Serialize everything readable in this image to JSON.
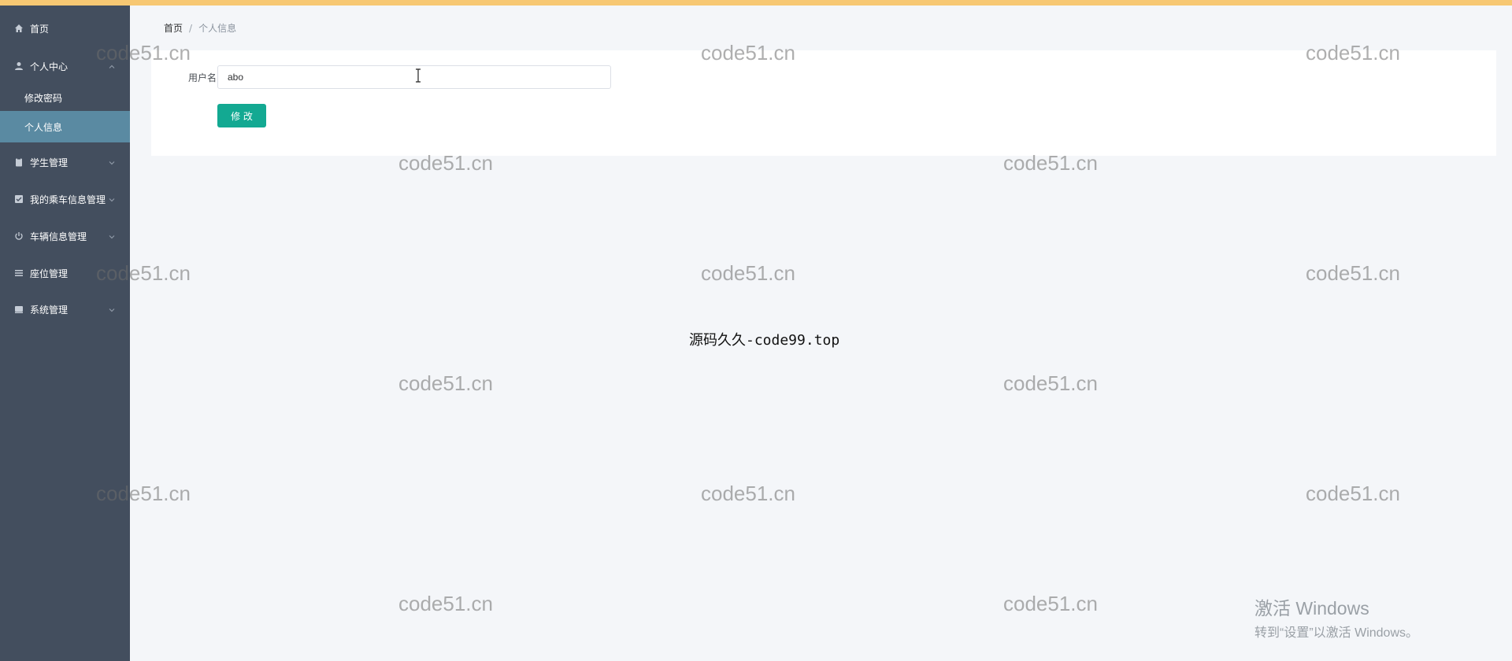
{
  "sidebar": {
    "items": [
      {
        "label": "首页",
        "icon": "home-icon"
      },
      {
        "label": "个人中心",
        "icon": "user-icon"
      },
      {
        "label": "学生管理",
        "icon": "clipboard-icon"
      },
      {
        "label": "我的乘车信息管理",
        "icon": "checkbox-icon"
      },
      {
        "label": "车辆信息管理",
        "icon": "power-icon"
      },
      {
        "label": "座位管理",
        "icon": "list-icon"
      },
      {
        "label": "系统管理",
        "icon": "drive-icon"
      }
    ],
    "submenu": [
      {
        "label": "修改密码",
        "active": false
      },
      {
        "label": "个人信息",
        "active": true
      }
    ]
  },
  "breadcrumb": {
    "home": "首页",
    "separator": "/",
    "current": "个人信息"
  },
  "form": {
    "username_label": "用户名",
    "username_value": "abo",
    "submit_label": "修 改"
  },
  "watermark": {
    "text": "code51.cn"
  },
  "center_text": "源码久久-code99.top",
  "activation": {
    "line1": "激活 Windows",
    "line2": "转到“设置”以激活 Windows。"
  },
  "colors": {
    "sidebar_bg": "#434e5e",
    "active_item_bg": "#5a8aa2",
    "primary_button": "#13a992",
    "top_stripe": "#f7c873"
  }
}
